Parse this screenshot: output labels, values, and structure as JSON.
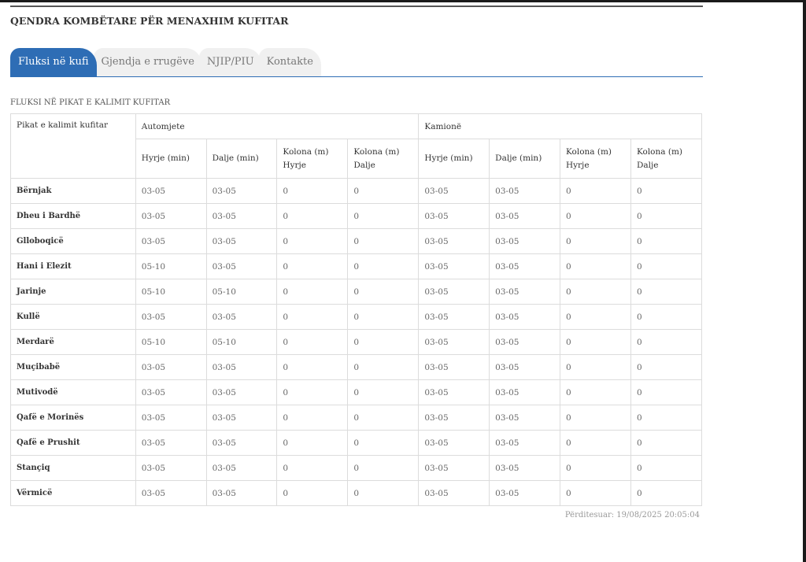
{
  "header": {
    "title": "QENDRA KOMBËTARE PËR MENAXHIM KUFITAR"
  },
  "tabs": [
    {
      "label": "Fluksi në kufi",
      "active": true
    },
    {
      "label": "Gjendja e rrugëve",
      "active": false
    },
    {
      "label": "NJIP/PIU",
      "active": false
    },
    {
      "label": "Kontakte",
      "active": false
    }
  ],
  "section": {
    "title": "FLUKSI NË PIKAT E KALIMIT KUFITAR"
  },
  "table": {
    "place_header": "Pikat e kalimit kufitar",
    "group_cars": "Automjete",
    "group_trucks": "Kamionë",
    "subheaders": [
      "Hyrje (min)",
      "Dalje (min)",
      "Kolona (m) Hyrje",
      "Kolona (m) Dalje",
      "Hyrje (min)",
      "Dalje (min)",
      "Kolona (m) Hyrje",
      "Kolona (m) Dalje"
    ],
    "rows": [
      {
        "place": "Bërnjak",
        "values": [
          "03-05",
          "03-05",
          "0",
          "0",
          "03-05",
          "03-05",
          "0",
          "0"
        ]
      },
      {
        "place": "Dheu i Bardhë",
        "values": [
          "03-05",
          "03-05",
          "0",
          "0",
          "03-05",
          "03-05",
          "0",
          "0"
        ]
      },
      {
        "place": "Glloboqicë",
        "values": [
          "03-05",
          "03-05",
          "0",
          "0",
          "03-05",
          "03-05",
          "0",
          "0"
        ]
      },
      {
        "place": "Hani i Elezit",
        "values": [
          "05-10",
          "03-05",
          "0",
          "0",
          "03-05",
          "03-05",
          "0",
          "0"
        ]
      },
      {
        "place": "Jarinje",
        "values": [
          "05-10",
          "05-10",
          "0",
          "0",
          "03-05",
          "03-05",
          "0",
          "0"
        ]
      },
      {
        "place": "Kullë",
        "values": [
          "03-05",
          "03-05",
          "0",
          "0",
          "03-05",
          "03-05",
          "0",
          "0"
        ]
      },
      {
        "place": "Merdarë",
        "values": [
          "05-10",
          "05-10",
          "0",
          "0",
          "03-05",
          "03-05",
          "0",
          "0"
        ]
      },
      {
        "place": "Muçibabë",
        "values": [
          "03-05",
          "03-05",
          "0",
          "0",
          "03-05",
          "03-05",
          "0",
          "0"
        ]
      },
      {
        "place": "Mutivodë",
        "values": [
          "03-05",
          "03-05",
          "0",
          "0",
          "03-05",
          "03-05",
          "0",
          "0"
        ]
      },
      {
        "place": "Qafë e Morinës",
        "values": [
          "03-05",
          "03-05",
          "0",
          "0",
          "03-05",
          "03-05",
          "0",
          "0"
        ]
      },
      {
        "place": "Qafë e Prushit",
        "values": [
          "03-05",
          "03-05",
          "0",
          "0",
          "03-05",
          "03-05",
          "0",
          "0"
        ]
      },
      {
        "place": "Stançiq",
        "values": [
          "03-05",
          "03-05",
          "0",
          "0",
          "03-05",
          "03-05",
          "0",
          "0"
        ]
      },
      {
        "place": "Vërmicë",
        "values": [
          "03-05",
          "03-05",
          "0",
          "0",
          "03-05",
          "03-05",
          "0",
          "0"
        ]
      }
    ]
  },
  "footer": {
    "updated": "Përditesuar: 19/08/2025 20:05:04"
  },
  "colors": {
    "accent": "#2e6db5",
    "border": "#dcdcdc"
  }
}
